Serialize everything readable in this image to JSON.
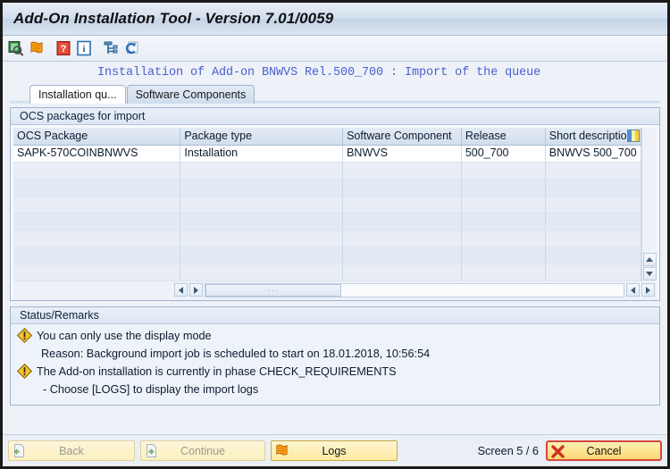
{
  "window": {
    "title": "Add-On Installation Tool - Version 7.01/0059"
  },
  "toolbar": {
    "items": [
      {
        "name": "display-search-icon",
        "tooltip": "Display"
      },
      {
        "name": "logs-scroll-icon",
        "tooltip": "Logs"
      },
      {
        "name": "help-question-icon",
        "tooltip": "Help"
      },
      {
        "name": "info-icon",
        "tooltip": "Information"
      },
      {
        "name": "tools-network-icon",
        "tooltip": "Tools"
      },
      {
        "name": "refresh-icon",
        "tooltip": "Refresh"
      }
    ]
  },
  "headline": "Installation of Add-on BNWVS Rel.500_700 : Import of the queue",
  "tabs": [
    {
      "label": "Installation qu...",
      "active": true
    },
    {
      "label": "Software Components",
      "active": false
    }
  ],
  "table_panel": {
    "title": "OCS packages for import",
    "columns": [
      "OCS Package",
      "Package type",
      "Software Component",
      "Release",
      "Short description"
    ],
    "rows": [
      [
        "SAPK-570COINBNWVS",
        "Installation",
        "BNWVS",
        "500_700",
        "BNWVS 500_700"
      ]
    ],
    "empty_row_count": 7,
    "column_config_icon": "column-settings-icon",
    "scroll": {
      "up_icon": "scroll-up-icon",
      "down_icon": "scroll-down-icon",
      "left_icon": "scroll-left-icon",
      "right_icon": "scroll-right-icon",
      "thumb_label": "···"
    }
  },
  "status_panel": {
    "title": "Status/Remarks",
    "lines": [
      {
        "icon": "warning-icon",
        "text": "You can only use the display mode",
        "indent": 0
      },
      {
        "icon": null,
        "text": "Reason: Background import job is scheduled to start on 18.01.2018, 10:56:54",
        "indent": 1
      },
      {
        "icon": "warning-icon",
        "text": "The Add-on installation is currently in phase CHECK_REQUIREMENTS",
        "indent": 0
      },
      {
        "icon": null,
        "text": "- Choose [LOGS] to display the import logs",
        "indent": 2
      }
    ]
  },
  "footer": {
    "back_label": "Back",
    "back_icon": "page-back-icon",
    "back_enabled": false,
    "continue_label": "Continue",
    "continue_icon": "page-forward-icon",
    "continue_enabled": false,
    "logs_label": "Logs",
    "logs_icon": "logs-scroll-icon",
    "screen_indicator": "Screen 5 / 6",
    "cancel_label": "Cancel",
    "cancel_icon": "red-x-icon"
  },
  "colors": {
    "titlebar": "#d3dfee",
    "headline_text": "#4a5fd0",
    "accent_button": "#fde9a0",
    "cancel_border": "#d6453c",
    "warning": "#f5c518",
    "grid_header": "#d3dfed",
    "empty_row": "#e8edf6"
  }
}
